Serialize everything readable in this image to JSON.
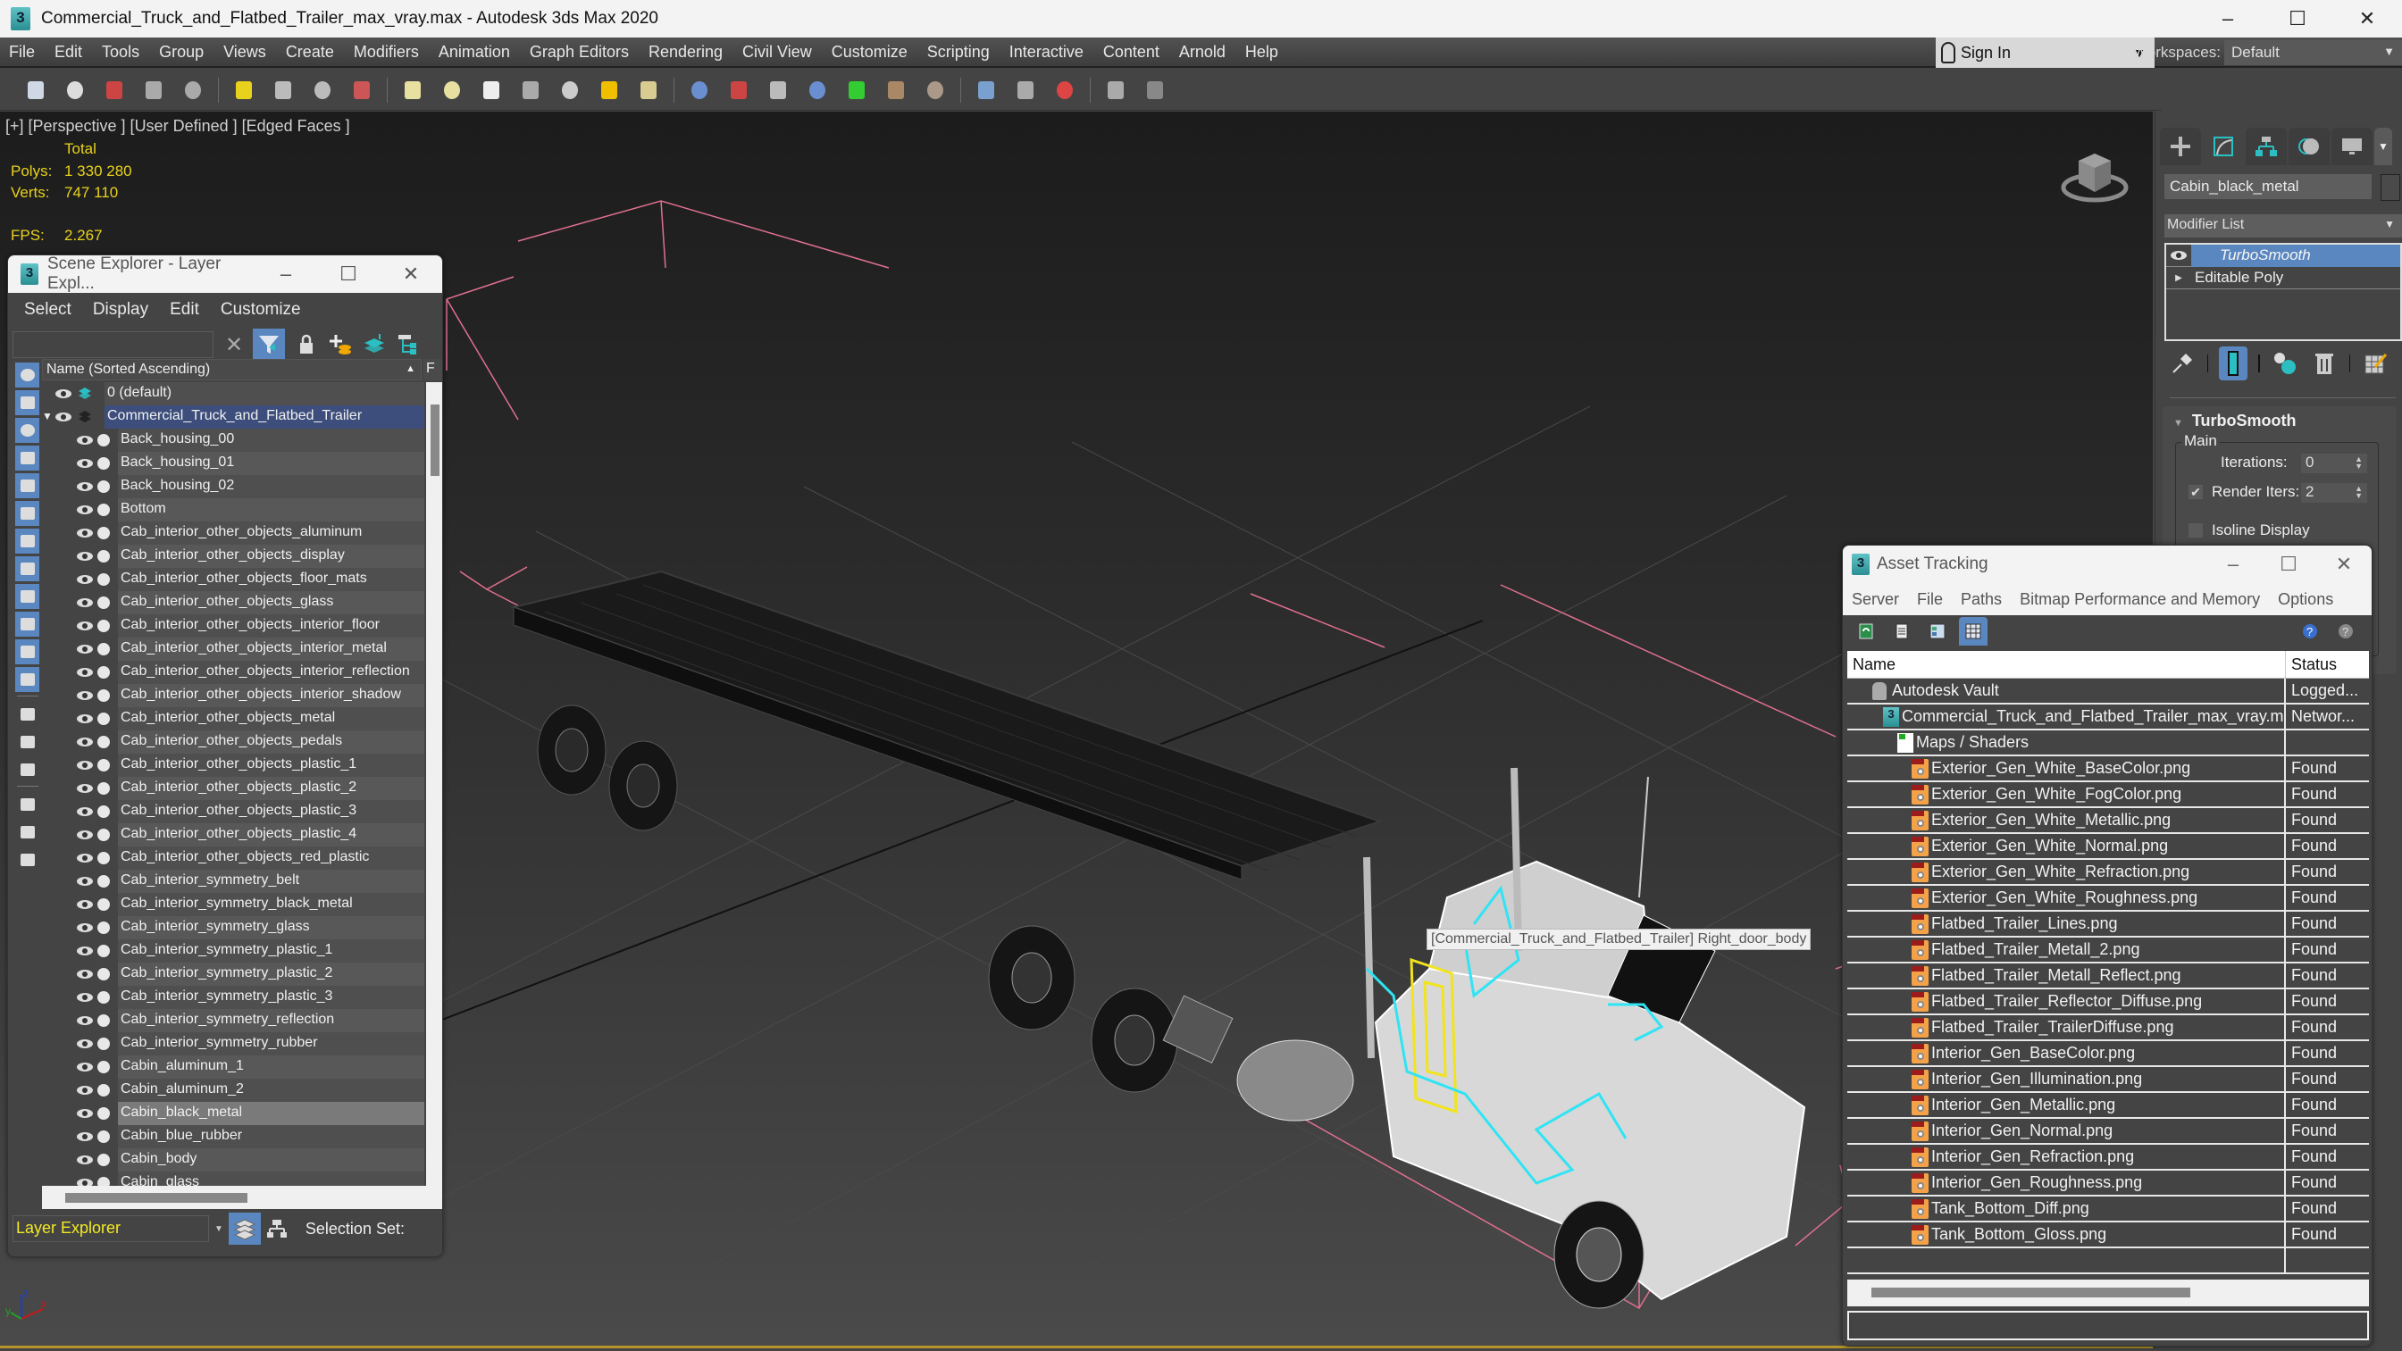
{
  "window": {
    "title": "Commercial_Truck_and_Flatbed_Trailer_max_vray.max - Autodesk 3ds Max 2020",
    "app_icon_label": "3",
    "minimize": "–",
    "maximize": "☐",
    "close": "✕"
  },
  "menubar": {
    "items": [
      "File",
      "Edit",
      "Tools",
      "Group",
      "Views",
      "Create",
      "Modifiers",
      "Animation",
      "Graph Editors",
      "Rendering",
      "Civil View",
      "Customize",
      "Scripting",
      "Interactive",
      "Content",
      "Arnold",
      "Help"
    ],
    "sign_in": "Sign In",
    "workspaces_label": "Workspaces:",
    "workspace_value": "Default"
  },
  "toolbar": {
    "icons": [
      "teapot-icon",
      "cloud-icon",
      "render-frame-icon",
      "scene-list-icon",
      "layer-list-icon",
      "light-lister-icon",
      "camera-icon",
      "camera-sequencer-icon",
      "render-movie-icon",
      "plane-icon",
      "sphere-icon",
      "glow-sphere-icon",
      "grass-object-icon",
      "cone-light-icon",
      "sun-icon",
      "egg-icon",
      "particles-icon",
      "material-ball-icon",
      "tower-icon",
      "flake-icon",
      "plant-icon",
      "hair-fur-icon",
      "displacement-icon",
      "blue-sphere-icon",
      "sequencer-icon",
      "render-elements-icon",
      "list-icon",
      "help-icon"
    ]
  },
  "viewport": {
    "label": "[+] [Perspective ] [User Defined ] [Edged Faces ]",
    "stats": {
      "total_label": "Total",
      "polys_label": "Polys:",
      "polys_value": "1 330 280",
      "verts_label": "Verts:",
      "verts_value": "747 110",
      "fps_label": "FPS:",
      "fps_value": "2.267"
    },
    "tooltip": "[Commercial_Truck_and_Flatbed_Trailer] Right_door_body",
    "axis": {
      "x": "x",
      "y": "y",
      "z": "z"
    }
  },
  "scene_explorer": {
    "title": "Scene Explorer - Layer Expl...",
    "menu": [
      "Select",
      "Display",
      "Edit",
      "Customize"
    ],
    "search_value": "",
    "column_header": "Name (Sorted Ascending)",
    "column_header2": "F",
    "layers": [
      {
        "name": "0 (default)"
      },
      {
        "name": "Commercial_Truck_and_Flatbed_Trailer"
      }
    ],
    "objects": [
      "Back_housing_00",
      "Back_housing_01",
      "Back_housing_02",
      "Bottom",
      "Cab_interior_other_objects_aluminum",
      "Cab_interior_other_objects_display",
      "Cab_interior_other_objects_floor_mats",
      "Cab_interior_other_objects_glass",
      "Cab_interior_other_objects_interior_floor",
      "Cab_interior_other_objects_interior_metal",
      "Cab_interior_other_objects_interior_reflection",
      "Cab_interior_other_objects_interior_shadow",
      "Cab_interior_other_objects_metal",
      "Cab_interior_other_objects_pedals",
      "Cab_interior_other_objects_plastic_1",
      "Cab_interior_other_objects_plastic_2",
      "Cab_interior_other_objects_plastic_3",
      "Cab_interior_other_objects_plastic_4",
      "Cab_interior_other_objects_red_plastic",
      "Cab_interior_symmetry_belt",
      "Cab_interior_symmetry_black_metal",
      "Cab_interior_symmetry_glass",
      "Cab_interior_symmetry_plastic_1",
      "Cab_interior_symmetry_plastic_2",
      "Cab_interior_symmetry_plastic_3",
      "Cab_interior_symmetry_reflection",
      "Cab_interior_symmetry_rubber",
      "Cabin_aluminum_1",
      "Cabin_aluminum_2",
      "Cabin_black_metal",
      "Cabin_blue_rubber",
      "Cabin_body",
      "Cabin_glass"
    ],
    "selected_object": "Cabin_black_metal",
    "explorer_select": "Layer Explorer",
    "selection_set_label": "Selection Set:"
  },
  "command_panel": {
    "object_name": "Cabin_black_metal",
    "modifier_list": "Modifier List",
    "stack": [
      {
        "label": "TurboSmooth",
        "active": true
      },
      {
        "label": "Editable Poly",
        "active": false
      }
    ],
    "rollout_title": "TurboSmooth",
    "group_label": "Main",
    "iterations_label": "Iterations:",
    "iterations_value": "0",
    "render_iters_label": "Render Iters:",
    "render_iters_value": "2",
    "render_iters_checked": true,
    "isoline_label": "Isoline Display",
    "isoline_checked": false
  },
  "asset_tracking": {
    "title": "Asset Tracking",
    "menu": [
      "Server",
      "File",
      "Paths",
      "Bitmap Performance and Memory",
      "Options"
    ],
    "columns": {
      "name": "Name",
      "status": "Status"
    },
    "rows": [
      {
        "name": "Autodesk Vault",
        "status": "Logged...",
        "level": 0,
        "type": "vault"
      },
      {
        "name": "Commercial_Truck_and_Flatbed_Trailer_max_vray.max",
        "status": "Networ...",
        "level": 1,
        "type": "max"
      },
      {
        "name": "Maps / Shaders",
        "status": "",
        "level": 2,
        "type": "maps"
      },
      {
        "name": "Exterior_Gen_White_BaseColor.png",
        "status": "Found",
        "level": 3,
        "type": "png"
      },
      {
        "name": "Exterior_Gen_White_FogColor.png",
        "status": "Found",
        "level": 3,
        "type": "png"
      },
      {
        "name": "Exterior_Gen_White_Metallic.png",
        "status": "Found",
        "level": 3,
        "type": "png"
      },
      {
        "name": "Exterior_Gen_White_Normal.png",
        "status": "Found",
        "level": 3,
        "type": "png"
      },
      {
        "name": "Exterior_Gen_White_Refraction.png",
        "status": "Found",
        "level": 3,
        "type": "png"
      },
      {
        "name": "Exterior_Gen_White_Roughness.png",
        "status": "Found",
        "level": 3,
        "type": "png"
      },
      {
        "name": "Flatbed_Trailer_Lines.png",
        "status": "Found",
        "level": 3,
        "type": "png"
      },
      {
        "name": "Flatbed_Trailer_Metall_2.png",
        "status": "Found",
        "level": 3,
        "type": "png"
      },
      {
        "name": "Flatbed_Trailer_Metall_Reflect.png",
        "status": "Found",
        "level": 3,
        "type": "png"
      },
      {
        "name": "Flatbed_Trailer_Reflector_Diffuse.png",
        "status": "Found",
        "level": 3,
        "type": "png"
      },
      {
        "name": "Flatbed_Trailer_TrailerDiffuse.png",
        "status": "Found",
        "level": 3,
        "type": "png"
      },
      {
        "name": "Interior_Gen_BaseColor.png",
        "status": "Found",
        "level": 3,
        "type": "png"
      },
      {
        "name": "Interior_Gen_Illumination.png",
        "status": "Found",
        "level": 3,
        "type": "png"
      },
      {
        "name": "Interior_Gen_Metallic.png",
        "status": "Found",
        "level": 3,
        "type": "png"
      },
      {
        "name": "Interior_Gen_Normal.png",
        "status": "Found",
        "level": 3,
        "type": "png"
      },
      {
        "name": "Interior_Gen_Refraction.png",
        "status": "Found",
        "level": 3,
        "type": "png"
      },
      {
        "name": "Interior_Gen_Roughness.png",
        "status": "Found",
        "level": 3,
        "type": "png"
      },
      {
        "name": "Tank_Bottom_Diff.png",
        "status": "Found",
        "level": 3,
        "type": "png"
      },
      {
        "name": "Tank_Bottom_Gloss.png",
        "status": "Found",
        "level": 3,
        "type": "png"
      }
    ]
  },
  "colors": {
    "accent": "#5b87c0",
    "stats_yellow": "#e8d21c",
    "selection_cyan": "#2fe4f4",
    "selection_yellow": "#f2e41c",
    "bbox_pink": "#e0708f",
    "timeline_gold": "#b8952a"
  }
}
